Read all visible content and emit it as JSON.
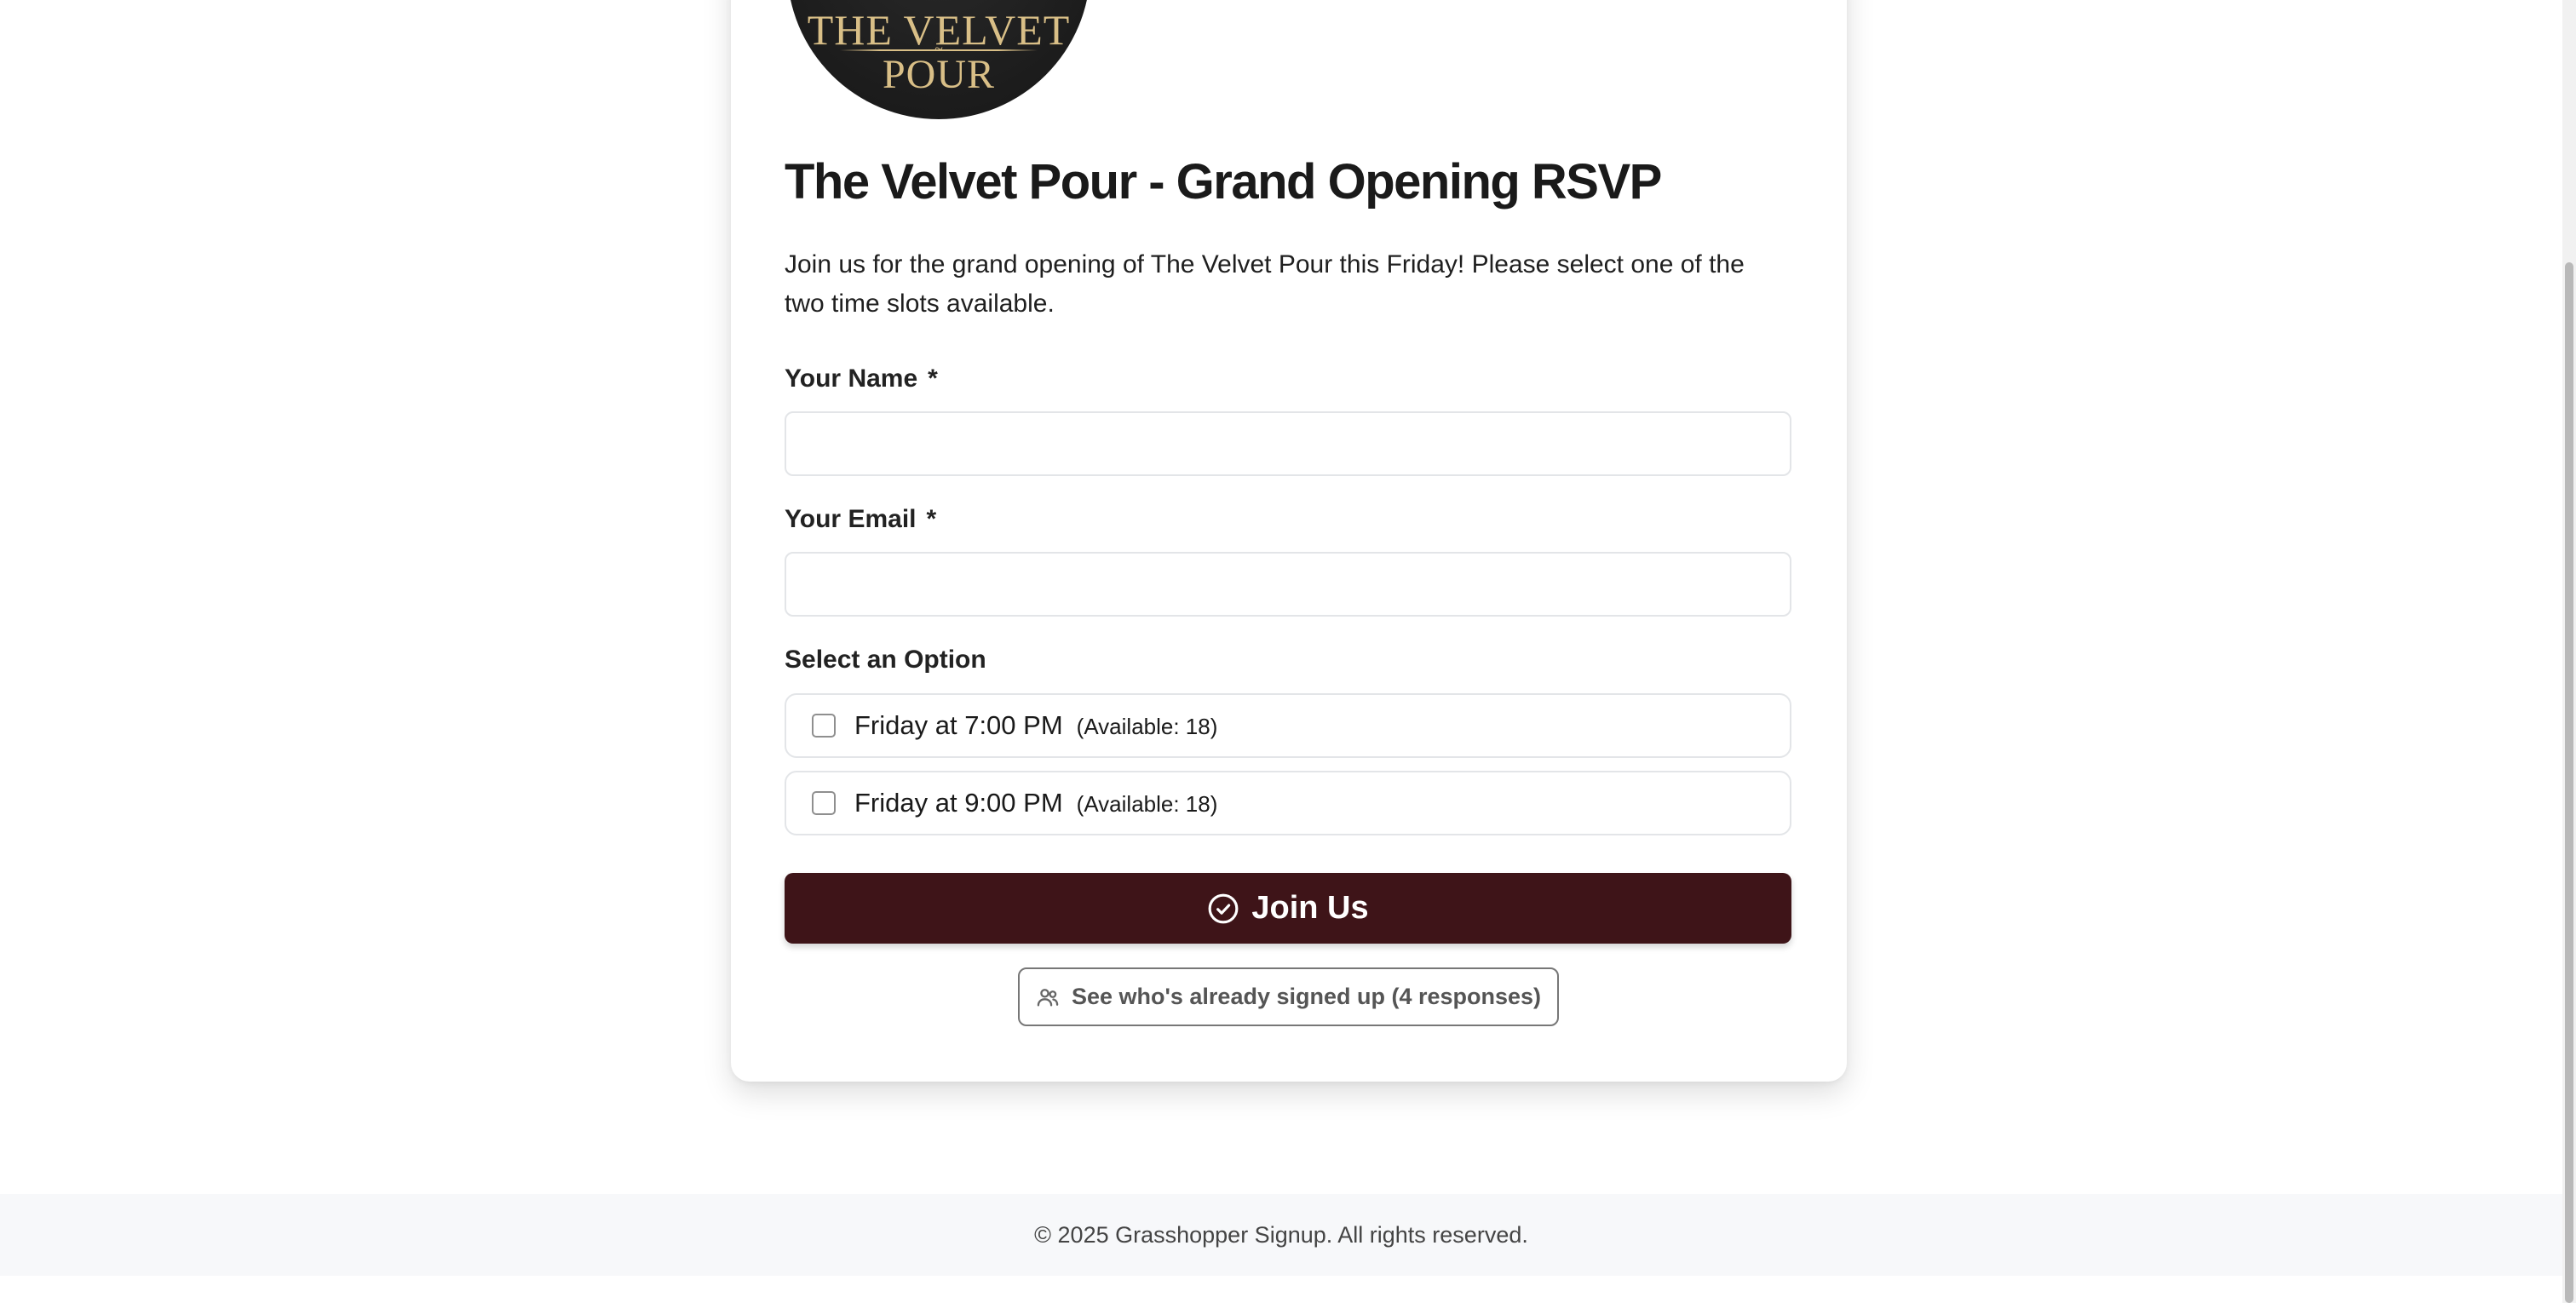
{
  "logo": {
    "line1": "THE VELVET",
    "line2": "POUR"
  },
  "form": {
    "title": "The Velvet Pour - Grand Opening RSVP",
    "description": "Join us for the grand opening of The Velvet Pour this Friday! Please select one of the two time slots available.",
    "name_label": "Your Name",
    "email_label": "Your Email",
    "required_marker": "*",
    "name_value": "",
    "email_value": "",
    "options_label": "Select an Option",
    "options": [
      {
        "label": "Friday at 7:00 PM",
        "availability": "(Available: 18)",
        "checked": false
      },
      {
        "label": "Friday at 9:00 PM",
        "availability": "(Available: 18)",
        "checked": false
      }
    ],
    "submit_label": "Join Us",
    "responses_label": "See who's already signed up (4 responses)"
  },
  "footer": {
    "text": "© 2025 Grasshopper Signup. All rights reserved."
  },
  "colors": {
    "primary_button": "#3e1418",
    "logo_gold": "#d9bf87",
    "logo_background": "#1c1c1c"
  },
  "icons": {
    "submit": "check-circle-icon",
    "responses": "users-icon"
  }
}
